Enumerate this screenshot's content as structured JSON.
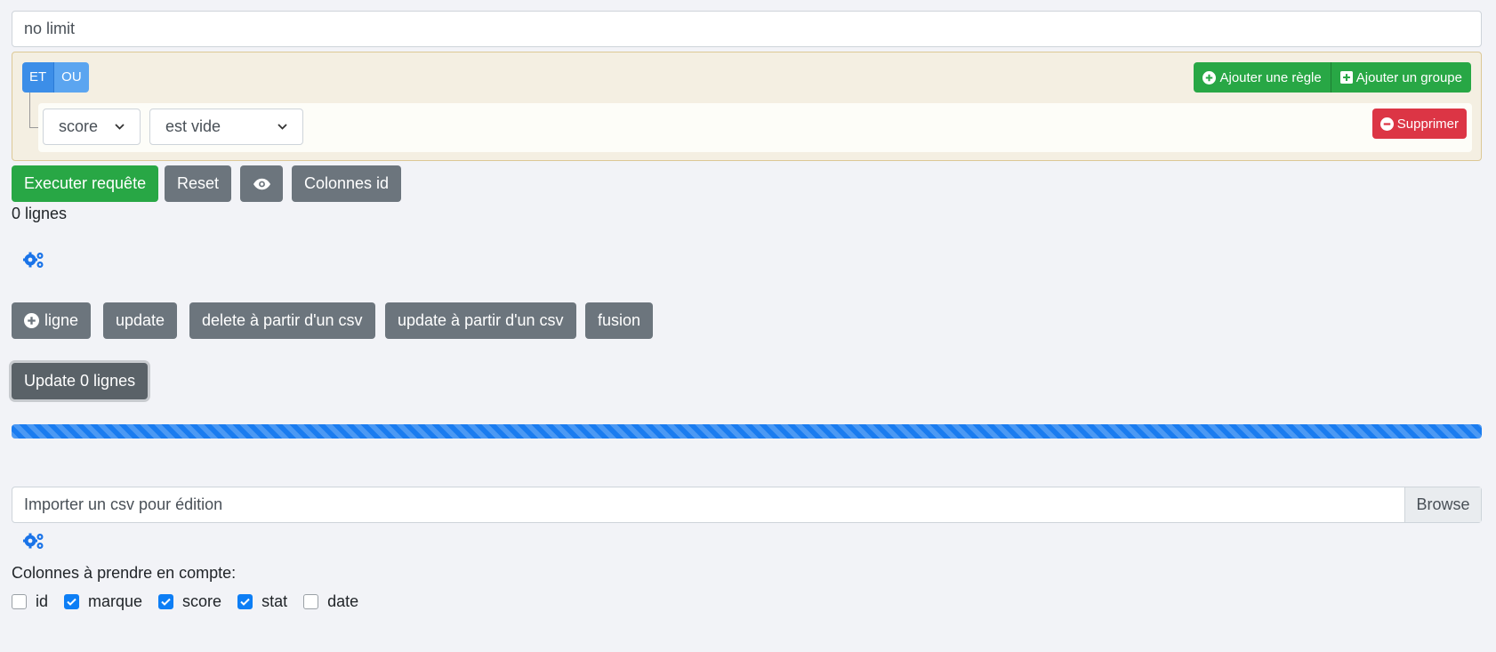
{
  "limit": {
    "value": "no limit"
  },
  "query_builder": {
    "conditions": [
      "ET",
      "OU"
    ],
    "add_rule_label": "Ajouter une règle",
    "add_group_label": "Ajouter un groupe",
    "rule": {
      "field": "score",
      "operator": "est vide",
      "delete_label": "Supprimer"
    }
  },
  "toolbar": {
    "execute_label": "Executer requête",
    "reset_label": "Reset",
    "id_columns_label": "Colonnes id"
  },
  "row_count": "0 lignes",
  "actions": {
    "add_row_label": "ligne",
    "update_label": "update",
    "delete_csv_label": "delete à partir d'un csv",
    "update_csv_label": "update à partir d'un csv",
    "merge_label": "fusion"
  },
  "update_rows_label": "Update 0 lignes",
  "progress": {
    "percent": 100,
    "color": "#1a7cf0",
    "striped": true
  },
  "csv_import": {
    "placeholder": "Importer un csv pour édition",
    "browse_label": "Browse"
  },
  "columns": {
    "label": "Colonnes à prendre en compte:",
    "items": [
      {
        "name": "id",
        "checked": false
      },
      {
        "name": "marque",
        "checked": true
      },
      {
        "name": "score",
        "checked": true
      },
      {
        "name": "stat",
        "checked": true
      },
      {
        "name": "date",
        "checked": false
      }
    ]
  },
  "icons": [
    "plus-circle-icon",
    "plus-square-icon",
    "minus-circle-icon",
    "eye-icon",
    "gears-icon",
    "check-icon",
    "chevron-down-icon"
  ],
  "colors": {
    "primary": "#1a73e8",
    "success": "#28a745",
    "danger": "#dc3545",
    "secondary": "#6c757d",
    "group_bg": "#f4efe2"
  }
}
